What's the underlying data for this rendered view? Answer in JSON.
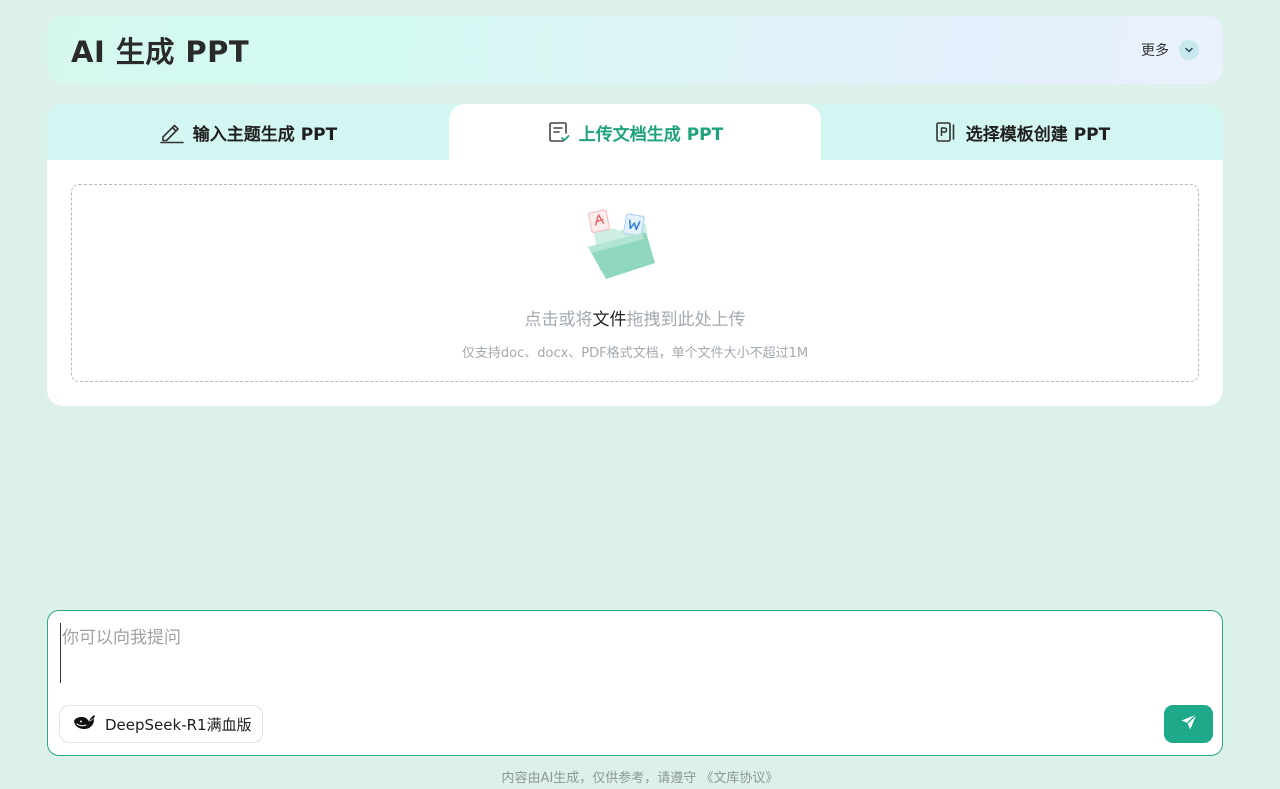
{
  "header": {
    "title": "AI 生成 PPT",
    "more_label": "更多",
    "more_icon": "chevron-down-icon"
  },
  "tabs": [
    {
      "label": "输入主题生成 PPT",
      "icon": "pencil-icon",
      "active": false
    },
    {
      "label": "上传文档生成 PPT",
      "icon": "document-check-icon",
      "active": true
    },
    {
      "label": "选择模板创建 PPT",
      "icon": "template-icon",
      "active": false
    }
  ],
  "upload": {
    "text_before": "点击或将",
    "text_highlight": "文件",
    "text_after": "拖拽到此处上传",
    "hint": "仅支持doc、docx、PDF格式文档，单个文件大小不超过1M",
    "illustration": "folder-with-files-icon"
  },
  "composer": {
    "placeholder": "你可以向我提问",
    "model_label": "DeepSeek-R1满血版",
    "model_icon": "deepseek-whale-icon",
    "send_icon": "send-icon"
  },
  "footer": {
    "text": "内容由AI生成，仅供参考，请遵守 ",
    "link": "《文库协议》"
  },
  "colors": {
    "background": "#dcf1ea",
    "accent": "#1ea98a",
    "tab_bar": "#d4f6f2"
  }
}
